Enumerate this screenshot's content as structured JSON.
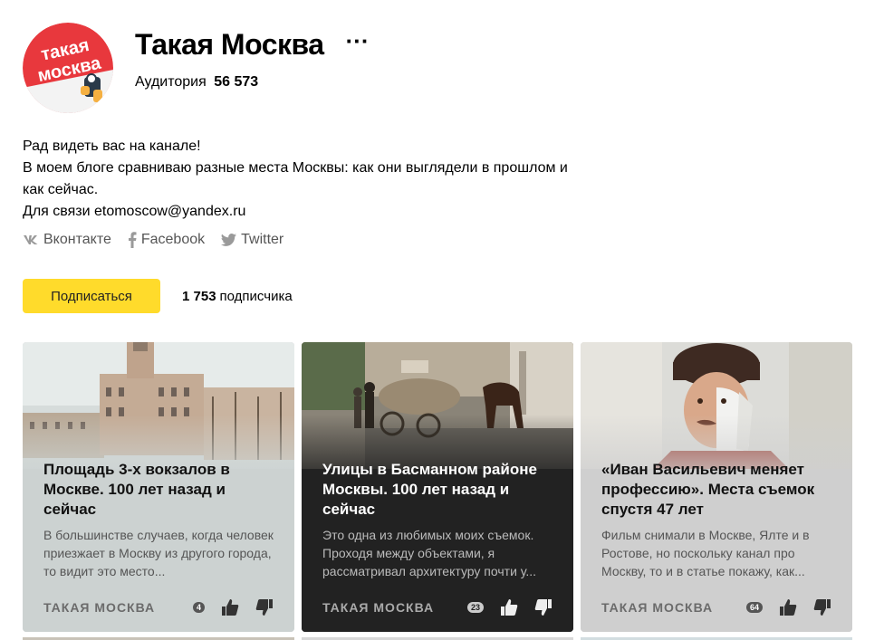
{
  "channel": {
    "title": "Такая Москва",
    "more_label": "···",
    "audience_label": "Аудитория",
    "audience_value": "56 573",
    "logo_text_line1": "такая",
    "logo_text_line2": "москва",
    "description": [
      "Рад видеть вас на канале!",
      "В моем блоге сравниваю разные места Москвы: как они выглядели в прошлом и как сейчас.",
      "Для связи etomoscow@yandex.ru"
    ],
    "socials": [
      {
        "label": "Вконтакте",
        "icon": "vk-icon"
      },
      {
        "label": "Facebook",
        "icon": "facebook-icon"
      },
      {
        "label": "Twitter",
        "icon": "twitter-icon"
      }
    ],
    "subscribe_label": "Подписаться",
    "subscribers_count": "1 753",
    "subscribers_label": "подписчика"
  },
  "colors": {
    "accent": "#ffdb2b",
    "logo_red": "#e8383d"
  },
  "cards": [
    {
      "title": "Площадь 3-х вокзалов в Москве. 100 лет назад и сейчас",
      "description": "В большинстве случаев, когда человек приезжает в Москву из другого города, то видит это место...",
      "source": "ТАКАЯ МОСКВА",
      "comments": "4",
      "theme": "light"
    },
    {
      "title": "Улицы в Басманном районе Москвы. 100 лет назад и сейчас",
      "description": "Это одна из любимых моих съемок. Проходя между объектами, я рассматривал архитектуру почти у...",
      "source": "ТАКАЯ МОСКВА",
      "comments": "23",
      "theme": "dark"
    },
    {
      "title": "«Иван Васильевич меняет профессию». Места съемок спустя 47 лет",
      "description": "Фильм снимали в Москве, Ялте и в Ростове, но поскольку канал про Москву, то и в статье покажу, как...",
      "source": "ТАКАЯ МОСКВА",
      "comments": "64",
      "theme": "grey"
    }
  ]
}
